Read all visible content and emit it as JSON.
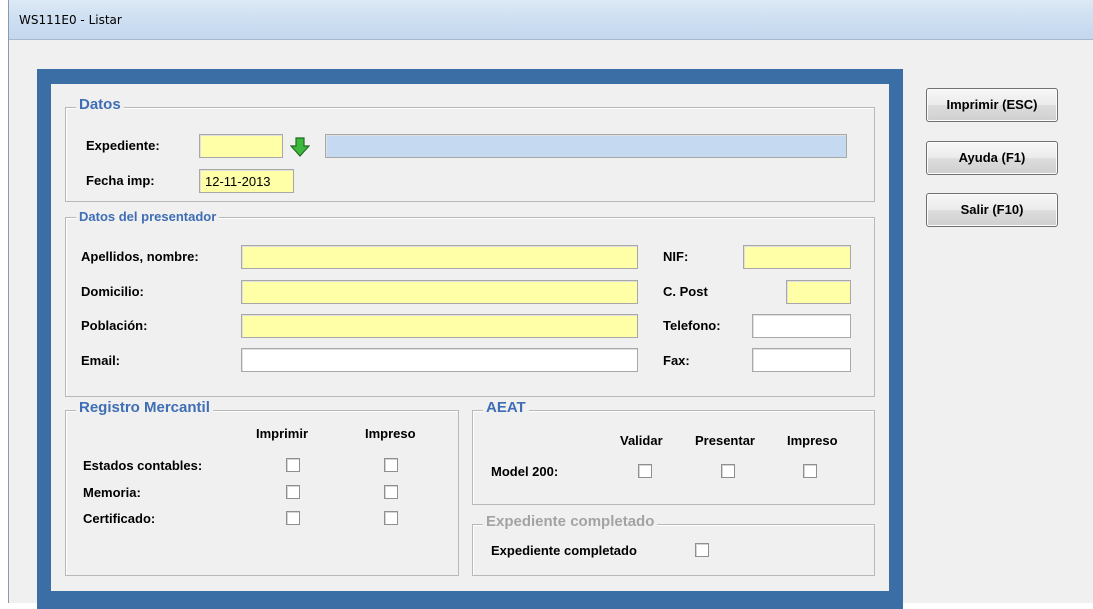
{
  "window": {
    "title": "WS111E0 - Listar"
  },
  "buttons": {
    "print": "Imprimir (ESC)",
    "help": "Ayuda (F1)",
    "exit": "Salir (F10)"
  },
  "datos": {
    "legend": "Datos",
    "expediente_label": "Expediente:",
    "expediente_value": "",
    "expediente_desc": "",
    "fecha_label": "Fecha imp:",
    "fecha_value": "12-11-2013"
  },
  "presentador": {
    "legend": "Datos del presentador",
    "apellidos_label": "Apellidos, nombre:",
    "apellidos_value": "",
    "domicilio_label": "Domicilio:",
    "domicilio_value": "",
    "poblacion_label": "Población:",
    "poblacion_value": "",
    "email_label": "Email:",
    "email_value": "",
    "nif_label": "NIF:",
    "nif_value": "",
    "cpost_label": "C. Post",
    "cpost_value": "",
    "telefono_label": "Telefono:",
    "telefono_value": "",
    "fax_label": "Fax:",
    "fax_value": ""
  },
  "registro": {
    "legend": "Registro Mercantil",
    "col_imprimir": "Imprimir",
    "col_impreso": "Impreso",
    "rows": [
      {
        "label": "Estados contables:",
        "imprimir": false,
        "impreso": false
      },
      {
        "label": "Memoria:",
        "imprimir": false,
        "impreso": false
      },
      {
        "label": "Certificado:",
        "imprimir": false,
        "impreso": false
      }
    ]
  },
  "aeat": {
    "legend": "AEAT",
    "col_validar": "Validar",
    "col_presentar": "Presentar",
    "col_impreso": "Impreso",
    "row_label": "Model 200:"
  },
  "completado": {
    "legend": "Expediente completado",
    "label": "Expediente completado"
  },
  "colors": {
    "frame_blue": "#3a6ea5",
    "required_field": "#ffffa8",
    "description_field": "#c5d9f1",
    "legend_blue": "#3f6eb5",
    "arrow_green": "#3cb83c"
  },
  "icons": {
    "lookup": "green-down-arrow-icon"
  }
}
